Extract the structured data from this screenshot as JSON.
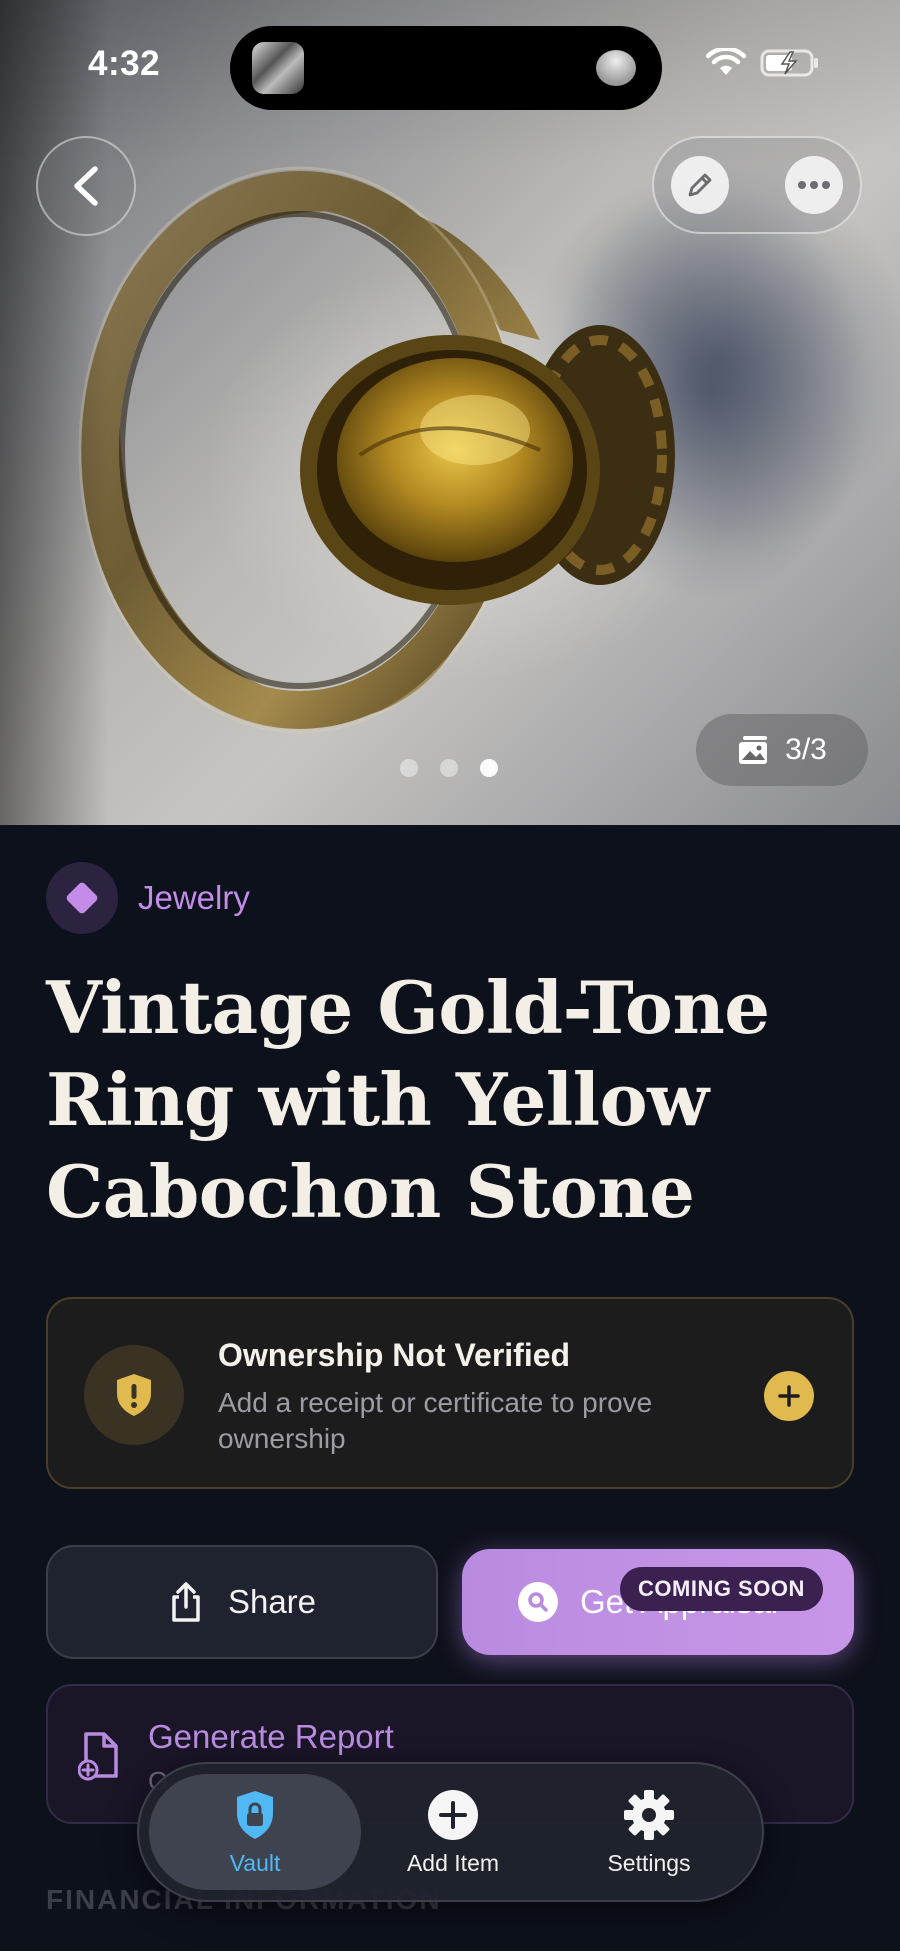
{
  "status_bar": {
    "time": "4:32",
    "icons": [
      "wifi-icon",
      "battery-charging-icon"
    ]
  },
  "hero": {
    "photo_counter": "3/3",
    "current_photo": 3,
    "total_photos": 3,
    "icons": {
      "back": "chevron-left-icon",
      "edit": "pencil-icon",
      "more": "ellipsis-icon",
      "gallery": "gallery-icon"
    }
  },
  "item": {
    "category": "Jewelry",
    "category_color": "#c28ce8",
    "title_lines": [
      "Vintage Gold-Tone",
      "Ring with Yellow",
      "Cabochon Stone"
    ]
  },
  "ownership": {
    "title": "Ownership Not Verified",
    "subtitle": "Add a receipt or certificate to prove ownership",
    "accent_color": "#e0b94f"
  },
  "actions": {
    "share_label": "Share",
    "appraisal_label": "Get Appraisal",
    "coming_soon_badge": "COMING SOON"
  },
  "report": {
    "title": "Generate Report",
    "subtitle": "G"
  },
  "sections": {
    "financial_label": "FINANCIAL INFORMATION"
  },
  "tabbar": {
    "tabs": [
      {
        "label": "Vault",
        "icon": "lock-shield-icon",
        "active": true
      },
      {
        "label": "Add Item",
        "icon": "plus-circle-icon",
        "active": false
      },
      {
        "label": "Settings",
        "icon": "gear-icon",
        "active": false
      }
    ],
    "active_color": "#4fb8f5"
  }
}
